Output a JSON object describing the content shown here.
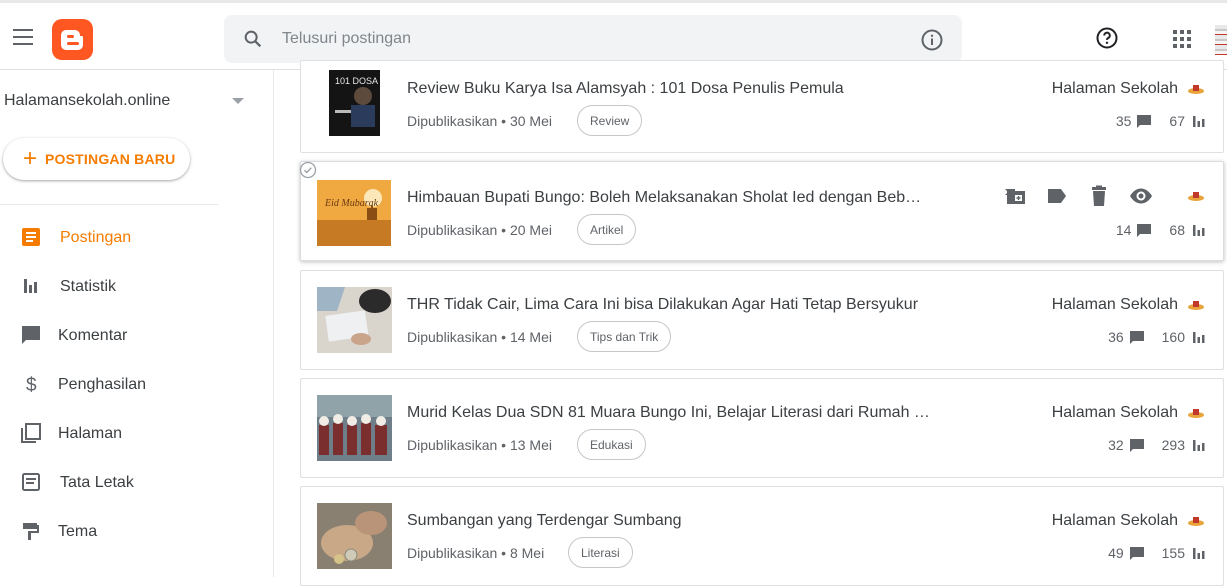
{
  "header": {
    "search_placeholder": "Telusuri postingan"
  },
  "sidebar": {
    "blog_name": "Halamansekolah.online",
    "new_post_label": "POSTINGAN BARU",
    "items": [
      {
        "label": "Postingan",
        "icon": "posts-icon",
        "active": true
      },
      {
        "label": "Statistik",
        "icon": "stats-icon",
        "active": false
      },
      {
        "label": "Komentar",
        "icon": "comment-icon",
        "active": false
      },
      {
        "label": "Penghasilan",
        "icon": "dollar-icon",
        "active": false
      },
      {
        "label": "Halaman",
        "icon": "pages-icon",
        "active": false
      },
      {
        "label": "Tata Letak",
        "icon": "layout-icon",
        "active": false
      },
      {
        "label": "Tema",
        "icon": "theme-icon",
        "active": false
      }
    ]
  },
  "posts": [
    {
      "title": "Review Buku Karya Isa Alamsyah : 101 Dosa Penulis Pemula",
      "status": "Dipublikasikan • 30 Mei",
      "label": "Review",
      "author": "Halaman Sekolah",
      "comments": "35",
      "views": "67"
    },
    {
      "title": "Himbauan Bupati Bungo: Boleh Melaksanakan Sholat Ied dengan Beb…",
      "status": "Dipublikasikan • 20 Mei",
      "label": "Artikel",
      "author": "",
      "comments": "14",
      "views": "68"
    },
    {
      "title": "THR Tidak Cair, Lima Cara Ini bisa Dilakukan Agar Hati Tetap Bersyukur",
      "status": "Dipublikasikan • 14 Mei",
      "label": "Tips dan Trik",
      "author": "Halaman Sekolah",
      "comments": "36",
      "views": "160"
    },
    {
      "title": "Murid Kelas Dua SDN 81 Muara Bungo Ini, Belajar Literasi dari Rumah …",
      "status": "Dipublikasikan • 13 Mei",
      "label": "Edukasi",
      "author": "Halaman Sekolah",
      "comments": "32",
      "views": "293"
    },
    {
      "title": "Sumbangan yang Terdengar Sumbang",
      "status": "Dipublikasikan • 8 Mei",
      "label": "Literasi",
      "author": "Halaman Sekolah",
      "comments": "49",
      "views": "155"
    }
  ],
  "thumbnails": {
    "post2_text": "Eid Mubarak",
    "post1_text": "101 DOSA"
  },
  "colors": {
    "accent": "#f57c00",
    "logo": "#ff5722"
  }
}
